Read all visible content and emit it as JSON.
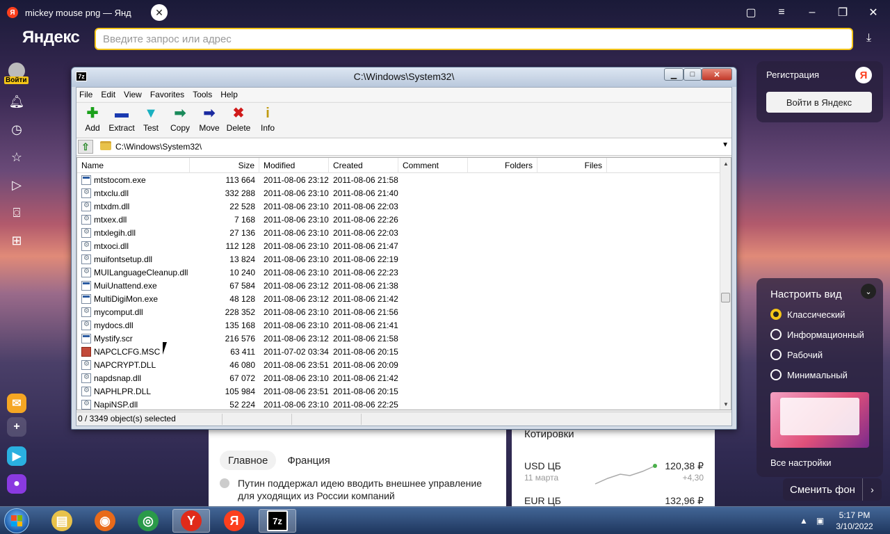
{
  "browser": {
    "tab_title": "mickey mouse png — Янд",
    "tab_favicon": "Я",
    "logo": "Яндекс",
    "address_placeholder": "Введите запрос или адрес",
    "login_badge": "Войти"
  },
  "sidebar_icons": [
    "bell-icon",
    "history-icon",
    "star-icon",
    "play-icon",
    "camera-icon",
    "grid-icon"
  ],
  "registration": {
    "title": "Регистрация",
    "button": "Войти в Яндекс",
    "logo_letter": "Я"
  },
  "view_settings": {
    "title": "Настроить вид",
    "options": [
      {
        "label": "Классический",
        "selected": true
      },
      {
        "label": "Информационный",
        "selected": false
      },
      {
        "label": "Рабочий",
        "selected": false
      },
      {
        "label": "Минимальный",
        "selected": false
      }
    ],
    "all_settings": "Все настройки",
    "change_background": "Сменить фон"
  },
  "news": {
    "tabs": [
      "Главное",
      "Франция"
    ],
    "item": "Путин поддержал идею вводить внешнее управление для уходящих из России компаний"
  },
  "quotes": {
    "title": "Котировки",
    "rows": [
      {
        "name": "USD ЦБ",
        "date": "11 марта",
        "value": "120,38 ₽",
        "change": "+4,30"
      },
      {
        "name": "EUR ЦБ",
        "value": "132,96 ₽"
      }
    ]
  },
  "sevenzip": {
    "title": "C:\\Windows\\System32\\",
    "app_icon": "7z",
    "menu": [
      "File",
      "Edit",
      "View",
      "Favorites",
      "Tools",
      "Help"
    ],
    "toolbar": [
      {
        "label": "Add",
        "icon": "add-icon",
        "glyph": "✚",
        "color": "#1aa01a"
      },
      {
        "label": "Extract",
        "icon": "extract-icon",
        "glyph": "▬",
        "color": "#1a3ab0"
      },
      {
        "label": "Test",
        "icon": "test-icon",
        "glyph": "▼",
        "color": "#1ab0c0"
      },
      {
        "label": "Copy",
        "icon": "copy-icon",
        "glyph": "➡",
        "color": "#1a8a5a"
      },
      {
        "label": "Move",
        "icon": "move-icon",
        "glyph": "➡",
        "color": "#1a2aa0"
      },
      {
        "label": "Delete",
        "icon": "delete-icon",
        "glyph": "✖",
        "color": "#d01a1a"
      },
      {
        "label": "Info",
        "icon": "info-icon",
        "glyph": "i",
        "color": "#c09a10"
      }
    ],
    "path": "C:\\Windows\\System32\\",
    "columns": [
      "Name",
      "Size",
      "Modified",
      "Created",
      "Comment",
      "Folders",
      "Files"
    ],
    "files": [
      {
        "name": "mtstocom.exe",
        "type": "exe",
        "size": "113 664",
        "modified": "2011-08-06 23:12",
        "created": "2011-08-06 21:58"
      },
      {
        "name": "mtxclu.dll",
        "type": "dll",
        "size": "332 288",
        "modified": "2011-08-06 23:10",
        "created": "2011-08-06 21:40"
      },
      {
        "name": "mtxdm.dll",
        "type": "dll",
        "size": "22 528",
        "modified": "2011-08-06 23:10",
        "created": "2011-08-06 22:03"
      },
      {
        "name": "mtxex.dll",
        "type": "dll",
        "size": "7 168",
        "modified": "2011-08-06 23:10",
        "created": "2011-08-06 22:26"
      },
      {
        "name": "mtxlegih.dll",
        "type": "dll",
        "size": "27 136",
        "modified": "2011-08-06 23:10",
        "created": "2011-08-06 22:03"
      },
      {
        "name": "mtxoci.dll",
        "type": "dll",
        "size": "112 128",
        "modified": "2011-08-06 23:10",
        "created": "2011-08-06 21:47"
      },
      {
        "name": "muifontsetup.dll",
        "type": "dll",
        "size": "13 824",
        "modified": "2011-08-06 23:10",
        "created": "2011-08-06 22:19"
      },
      {
        "name": "MUILanguageCleanup.dll",
        "type": "dll",
        "size": "10 240",
        "modified": "2011-08-06 23:10",
        "created": "2011-08-06 22:23"
      },
      {
        "name": "MuiUnattend.exe",
        "type": "exe",
        "size": "67 584",
        "modified": "2011-08-06 23:12",
        "created": "2011-08-06 21:38"
      },
      {
        "name": "MultiDigiMon.exe",
        "type": "exe",
        "size": "48 128",
        "modified": "2011-08-06 23:12",
        "created": "2011-08-06 21:42"
      },
      {
        "name": "mycomput.dll",
        "type": "dll",
        "size": "228 352",
        "modified": "2011-08-06 23:10",
        "created": "2011-08-06 21:56"
      },
      {
        "name": "mydocs.dll",
        "type": "dll",
        "size": "135 168",
        "modified": "2011-08-06 23:10",
        "created": "2011-08-06 21:41"
      },
      {
        "name": "Mystify.scr",
        "type": "exe",
        "size": "216 576",
        "modified": "2011-08-06 23:12",
        "created": "2011-08-06 21:58"
      },
      {
        "name": "NAPCLCFG.MSC",
        "type": "msc",
        "size": "63 411",
        "modified": "2011-07-02 03:34",
        "created": "2011-08-06 20:15"
      },
      {
        "name": "NAPCRYPT.DLL",
        "type": "dll",
        "size": "46 080",
        "modified": "2011-08-06 23:51",
        "created": "2011-08-06 20:09"
      },
      {
        "name": "napdsnap.dll",
        "type": "dll",
        "size": "67 072",
        "modified": "2011-08-06 23:10",
        "created": "2011-08-06 21:42"
      },
      {
        "name": "NAPHLPR.DLL",
        "type": "dll",
        "size": "105 984",
        "modified": "2011-08-06 23:51",
        "created": "2011-08-06 20:15"
      },
      {
        "name": "NapiNSP.dll",
        "type": "dll",
        "size": "52 224",
        "modified": "2011-08-06 23:10",
        "created": "2011-08-06 22:25"
      }
    ],
    "status": "0 / 3349 object(s) selected"
  },
  "taskbar": {
    "apps": [
      {
        "name": "explorer-icon",
        "color": "#e8c24a",
        "glyph": "▤",
        "active": false
      },
      {
        "name": "firefox-icon",
        "color": "#e86a1a",
        "glyph": "◉",
        "active": false
      },
      {
        "name": "chrome-icon",
        "color": "#2a9a4a",
        "glyph": "◎",
        "active": false
      },
      {
        "name": "yandex-browser-icon",
        "color": "#e02a1a",
        "glyph": "Y",
        "active": true
      },
      {
        "name": "yandex-icon",
        "color": "#fc3f1d",
        "glyph": "Я",
        "active": false
      },
      {
        "name": "7zip-icon",
        "color": "#000000",
        "glyph": "7z",
        "active": true
      }
    ],
    "time": "5:17 PM",
    "date": "3/10/2022"
  },
  "colors": {
    "accent": "#f5c518",
    "yandex_red": "#fc3f1d"
  }
}
